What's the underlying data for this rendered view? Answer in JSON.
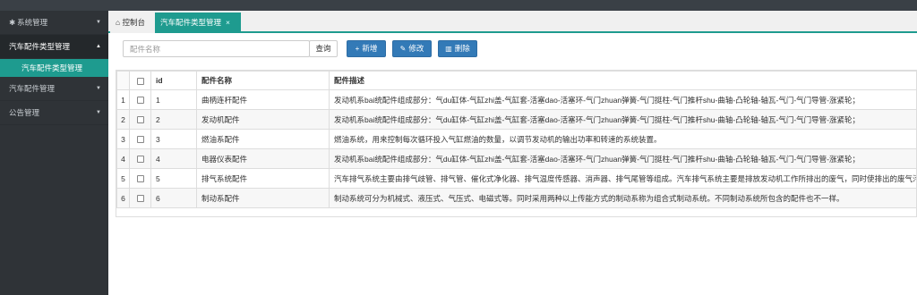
{
  "sidebar": {
    "items": [
      {
        "label": "系统管理"
      },
      {
        "label": "汽车配件类型管理"
      },
      {
        "label": "汽车配件类型管理"
      },
      {
        "label": "汽车配件管理"
      },
      {
        "label": "公告管理"
      }
    ]
  },
  "tabs": {
    "home": "控制台",
    "current": "汽车配件类型管理",
    "close": "×"
  },
  "toolbar": {
    "search_placeholder": "配件名称",
    "query": "查询",
    "add": "新增",
    "edit": "修改",
    "delete": "删除"
  },
  "table": {
    "headers": [
      "id",
      "配件名称",
      "配件描述"
    ],
    "rows": [
      {
        "num": "1",
        "id": "1",
        "name": "曲柄连杆配件",
        "desc": "发动机系bai统配件组成部分：气du缸体-气缸zhi盖-气缸套-活塞dao-活塞环-气门zhuan弹簧-气门挺柱-气门推杆shu-曲轴-凸轮轴-轴瓦-气门-气门导管-涨紧轮；"
      },
      {
        "num": "2",
        "id": "2",
        "name": "发动机配件",
        "desc": "发动机系bai统配件组成部分：气du缸体-气缸zhi盖-气缸套-活塞dao-活塞环-气门zhuan弹簧-气门挺柱-气门推杆shu-曲轴-凸轮轴-轴瓦-气门-气门导管-涨紧轮；"
      },
      {
        "num": "3",
        "id": "3",
        "name": "燃油系配件",
        "desc": "燃油系统，用来控制每次循环投入气缸燃油的数量，以调节发动机的输出功率和转速的系统装置。"
      },
      {
        "num": "4",
        "id": "4",
        "name": "电器仪表配件",
        "desc": "发动机系bai统配件组成部分：气du缸体-气缸zhi盖-气缸套-活塞dao-活塞环-气门zhuan弹簧-气门挺柱-气门推杆shu-曲轴-凸轮轴-轴瓦-气门-气门导管-涨紧轮；"
      },
      {
        "num": "5",
        "id": "5",
        "name": "排气系统配件",
        "desc": "汽车排气系统主要由排气歧管、排气管、催化式净化器、排气温度传感器、消声器、排气尾管等组成。汽车排气系统主要是排放发动机工作所排出的废气，同时使排出的废气污"
      },
      {
        "num": "6",
        "id": "6",
        "name": "制动系配件",
        "desc": "制动系统可分为机械式、液压式、气压式、电磁式等。同时采用两种以上传能方式的制动系称为组合式制动系统。不同制动系统所包含的配件也不一样。"
      }
    ]
  },
  "colors": {
    "accent": "#1e9b8f",
    "primary": "#337ab7",
    "sidebar": "#2f3337"
  }
}
